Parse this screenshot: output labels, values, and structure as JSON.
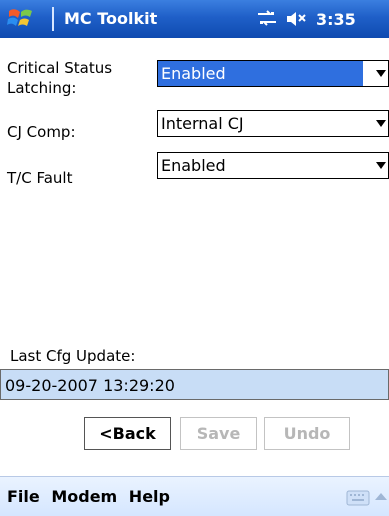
{
  "titlebar": {
    "app_title": "MC Toolkit",
    "time": "3:35",
    "icons": [
      "start-logo-icon",
      "connectivity-icon",
      "speaker-muted-icon"
    ]
  },
  "form": {
    "fields": [
      {
        "label": "Critical Status Latching:",
        "value": "Enabled"
      },
      {
        "label": "CJ Comp:",
        "value": "Internal CJ"
      },
      {
        "label": "T/C Fault",
        "value": "Enabled"
      }
    ],
    "last_update": {
      "label": "Last Cfg Update:",
      "value": "09-20-2007 13:29:20"
    }
  },
  "buttons": {
    "back": "<Back",
    "save": "Save",
    "undo": "Undo"
  },
  "menubar": {
    "items": [
      "File",
      "Modem",
      "Help"
    ]
  },
  "colors": {
    "title_bar": "#1f5fc8",
    "selected_dropdown": "#2f6fdf",
    "info_box": "#c8ddf6",
    "disabled_text": "#b7b7b7",
    "menu_bar": "#d5e6ff"
  }
}
